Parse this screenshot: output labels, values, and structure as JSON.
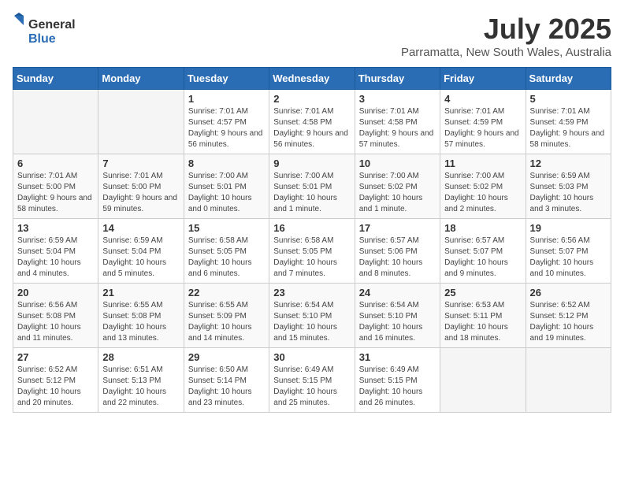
{
  "header": {
    "logo_general": "General",
    "logo_blue": "Blue",
    "month_year": "July 2025",
    "location": "Parramatta, New South Wales, Australia"
  },
  "days_of_week": [
    "Sunday",
    "Monday",
    "Tuesday",
    "Wednesday",
    "Thursday",
    "Friday",
    "Saturday"
  ],
  "weeks": [
    [
      {
        "day": "",
        "info": ""
      },
      {
        "day": "",
        "info": ""
      },
      {
        "day": "1",
        "info": "Sunrise: 7:01 AM\nSunset: 4:57 PM\nDaylight: 9 hours and 56 minutes."
      },
      {
        "day": "2",
        "info": "Sunrise: 7:01 AM\nSunset: 4:58 PM\nDaylight: 9 hours and 56 minutes."
      },
      {
        "day": "3",
        "info": "Sunrise: 7:01 AM\nSunset: 4:58 PM\nDaylight: 9 hours and 57 minutes."
      },
      {
        "day": "4",
        "info": "Sunrise: 7:01 AM\nSunset: 4:59 PM\nDaylight: 9 hours and 57 minutes."
      },
      {
        "day": "5",
        "info": "Sunrise: 7:01 AM\nSunset: 4:59 PM\nDaylight: 9 hours and 58 minutes."
      }
    ],
    [
      {
        "day": "6",
        "info": "Sunrise: 7:01 AM\nSunset: 5:00 PM\nDaylight: 9 hours and 58 minutes."
      },
      {
        "day": "7",
        "info": "Sunrise: 7:01 AM\nSunset: 5:00 PM\nDaylight: 9 hours and 59 minutes."
      },
      {
        "day": "8",
        "info": "Sunrise: 7:00 AM\nSunset: 5:01 PM\nDaylight: 10 hours and 0 minutes."
      },
      {
        "day": "9",
        "info": "Sunrise: 7:00 AM\nSunset: 5:01 PM\nDaylight: 10 hours and 1 minute."
      },
      {
        "day": "10",
        "info": "Sunrise: 7:00 AM\nSunset: 5:02 PM\nDaylight: 10 hours and 1 minute."
      },
      {
        "day": "11",
        "info": "Sunrise: 7:00 AM\nSunset: 5:02 PM\nDaylight: 10 hours and 2 minutes."
      },
      {
        "day": "12",
        "info": "Sunrise: 6:59 AM\nSunset: 5:03 PM\nDaylight: 10 hours and 3 minutes."
      }
    ],
    [
      {
        "day": "13",
        "info": "Sunrise: 6:59 AM\nSunset: 5:04 PM\nDaylight: 10 hours and 4 minutes."
      },
      {
        "day": "14",
        "info": "Sunrise: 6:59 AM\nSunset: 5:04 PM\nDaylight: 10 hours and 5 minutes."
      },
      {
        "day": "15",
        "info": "Sunrise: 6:58 AM\nSunset: 5:05 PM\nDaylight: 10 hours and 6 minutes."
      },
      {
        "day": "16",
        "info": "Sunrise: 6:58 AM\nSunset: 5:05 PM\nDaylight: 10 hours and 7 minutes."
      },
      {
        "day": "17",
        "info": "Sunrise: 6:57 AM\nSunset: 5:06 PM\nDaylight: 10 hours and 8 minutes."
      },
      {
        "day": "18",
        "info": "Sunrise: 6:57 AM\nSunset: 5:07 PM\nDaylight: 10 hours and 9 minutes."
      },
      {
        "day": "19",
        "info": "Sunrise: 6:56 AM\nSunset: 5:07 PM\nDaylight: 10 hours and 10 minutes."
      }
    ],
    [
      {
        "day": "20",
        "info": "Sunrise: 6:56 AM\nSunset: 5:08 PM\nDaylight: 10 hours and 11 minutes."
      },
      {
        "day": "21",
        "info": "Sunrise: 6:55 AM\nSunset: 5:08 PM\nDaylight: 10 hours and 13 minutes."
      },
      {
        "day": "22",
        "info": "Sunrise: 6:55 AM\nSunset: 5:09 PM\nDaylight: 10 hours and 14 minutes."
      },
      {
        "day": "23",
        "info": "Sunrise: 6:54 AM\nSunset: 5:10 PM\nDaylight: 10 hours and 15 minutes."
      },
      {
        "day": "24",
        "info": "Sunrise: 6:54 AM\nSunset: 5:10 PM\nDaylight: 10 hours and 16 minutes."
      },
      {
        "day": "25",
        "info": "Sunrise: 6:53 AM\nSunset: 5:11 PM\nDaylight: 10 hours and 18 minutes."
      },
      {
        "day": "26",
        "info": "Sunrise: 6:52 AM\nSunset: 5:12 PM\nDaylight: 10 hours and 19 minutes."
      }
    ],
    [
      {
        "day": "27",
        "info": "Sunrise: 6:52 AM\nSunset: 5:12 PM\nDaylight: 10 hours and 20 minutes."
      },
      {
        "day": "28",
        "info": "Sunrise: 6:51 AM\nSunset: 5:13 PM\nDaylight: 10 hours and 22 minutes."
      },
      {
        "day": "29",
        "info": "Sunrise: 6:50 AM\nSunset: 5:14 PM\nDaylight: 10 hours and 23 minutes."
      },
      {
        "day": "30",
        "info": "Sunrise: 6:49 AM\nSunset: 5:15 PM\nDaylight: 10 hours and 25 minutes."
      },
      {
        "day": "31",
        "info": "Sunrise: 6:49 AM\nSunset: 5:15 PM\nDaylight: 10 hours and 26 minutes."
      },
      {
        "day": "",
        "info": ""
      },
      {
        "day": "",
        "info": ""
      }
    ]
  ]
}
